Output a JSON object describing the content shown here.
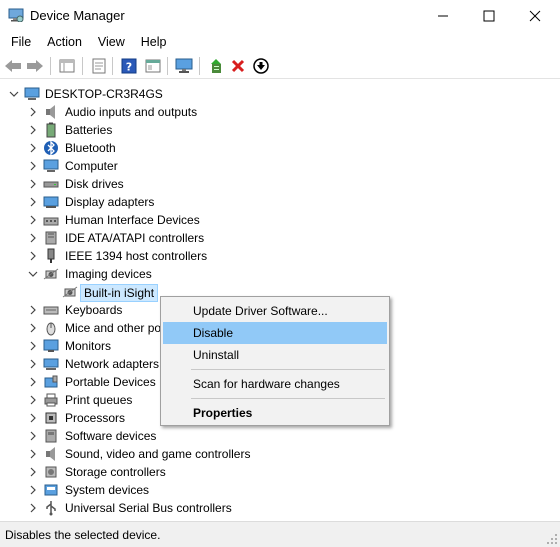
{
  "window": {
    "title": "Device Manager",
    "minimize_glyph": "—",
    "maximize_glyph": "☐",
    "close_glyph": "✕"
  },
  "menu": [
    "File",
    "Action",
    "View",
    "Help"
  ],
  "toolbar": {
    "icons": [
      "back-icon",
      "forward-icon",
      "properties-icon",
      "show-hide-icon",
      "help-icon",
      "view-icon",
      "monitor-icon",
      "update-driver-icon",
      "uninstall-icon",
      "disable-icon"
    ]
  },
  "tree": {
    "root": "DESKTOP-CR3R4GS",
    "items": [
      {
        "label": "Audio inputs and outputs",
        "icon": "speaker-icon"
      },
      {
        "label": "Batteries",
        "icon": "battery-icon"
      },
      {
        "label": "Bluetooth",
        "icon": "bluetooth-icon"
      },
      {
        "label": "Computer",
        "icon": "computer-icon"
      },
      {
        "label": "Disk drives",
        "icon": "disk-icon"
      },
      {
        "label": "Display adapters",
        "icon": "display-icon"
      },
      {
        "label": "Human Interface Devices",
        "icon": "hid-icon"
      },
      {
        "label": "IDE ATA/ATAPI controllers",
        "icon": "ide-icon"
      },
      {
        "label": "IEEE 1394 host controllers",
        "icon": "ieee-icon"
      },
      {
        "label": "Imaging devices",
        "icon": "camera-icon",
        "expanded": true
      },
      {
        "label": "Keyboards",
        "icon": "keyboard-icon"
      },
      {
        "label": "Mice and other po",
        "icon": "mouse-icon"
      },
      {
        "label": "Monitors",
        "icon": "monitor-icon"
      },
      {
        "label": "Network adapters",
        "icon": "network-icon"
      },
      {
        "label": "Portable Devices",
        "icon": "portable-icon"
      },
      {
        "label": "Print queues",
        "icon": "printer-icon"
      },
      {
        "label": "Processors",
        "icon": "cpu-icon"
      },
      {
        "label": "Software devices",
        "icon": "software-icon"
      },
      {
        "label": "Sound, video and game controllers",
        "icon": "speaker-icon"
      },
      {
        "label": "Storage controllers",
        "icon": "storage-icon"
      },
      {
        "label": "System devices",
        "icon": "system-icon"
      },
      {
        "label": "Universal Serial Bus controllers",
        "icon": "usb-icon"
      }
    ],
    "child": {
      "label": "Built-in iSight",
      "icon": "camera-icon"
    }
  },
  "context_menu": {
    "update": "Update Driver Software...",
    "disable": "Disable",
    "uninstall": "Uninstall",
    "scan": "Scan for hardware changes",
    "properties": "Properties"
  },
  "status": "Disables the selected device.",
  "colors": {
    "highlight": "#91c9f7",
    "selection": "#cce8ff",
    "accent": "#1e6fc8",
    "error_red": "#d81e1e"
  }
}
